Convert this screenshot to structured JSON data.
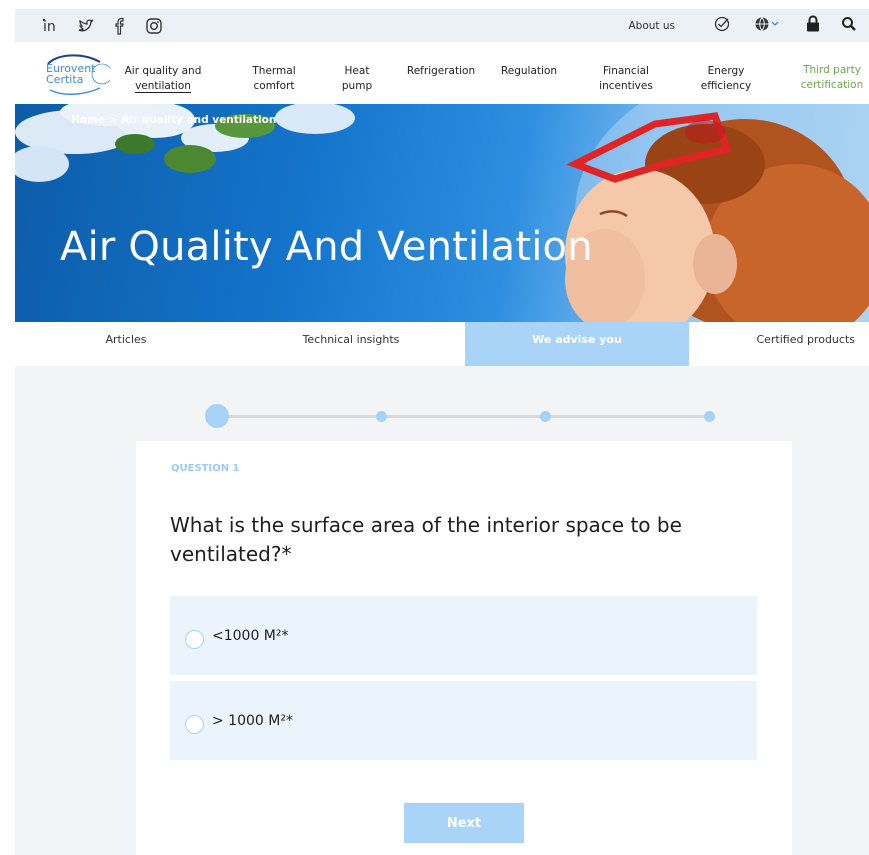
{
  "social": [
    "linkedin-icon",
    "twitter-icon",
    "facebook-icon",
    "instagram-icon"
  ],
  "topbar": {
    "about_label": "About us"
  },
  "logo": {
    "line1": "Eurovent",
    "line2": "Certita"
  },
  "nav": {
    "items": [
      {
        "label1": "Air quality and",
        "label2": "ventilation"
      },
      {
        "label1": "Thermal",
        "label2": "comfort"
      },
      {
        "label1": "Heat",
        "label2": "pump"
      },
      {
        "label1": "Refrigeration",
        "label2": ""
      },
      {
        "label1": "Regulation",
        "label2": ""
      },
      {
        "label1": "Financial",
        "label2": "incentives"
      },
      {
        "label1": "Energy",
        "label2": "efficiency"
      },
      {
        "label1": "Third party",
        "label2": "certification"
      }
    ]
  },
  "hero": {
    "breadcrumb": "Home > Air quality and ventilation",
    "title": "Air Quality And Ventilation"
  },
  "subtabs": [
    "Articles",
    "Technical insights",
    "We advise you",
    "Certified products"
  ],
  "quiz": {
    "question_number": "QUESTION 1",
    "question": "What is the surface area of the interior space to be ventilated?*",
    "options": [
      "<1000 M²*",
      "> 1000 M²*"
    ],
    "next_label": "Next"
  },
  "colors": {
    "accent": "#a9d4f7",
    "option_bg": "#ebf4fd",
    "green": "#6aa84f",
    "topbar": "#ecf1f5"
  }
}
